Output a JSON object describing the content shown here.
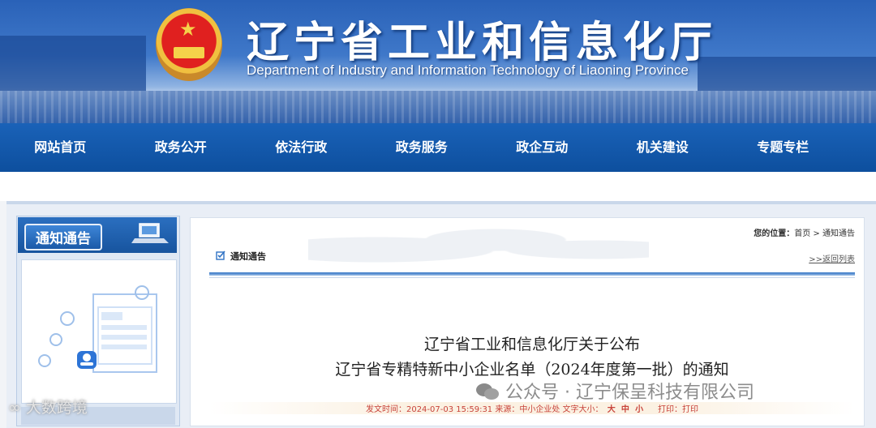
{
  "header": {
    "title": "辽宁省工业和信息化厅",
    "subtitle": "Department of Industry and Information Technology of Liaoning Province"
  },
  "nav": {
    "items": [
      {
        "label": "网站首页"
      },
      {
        "label": "政务公开"
      },
      {
        "label": "依法行政"
      },
      {
        "label": "政务服务"
      },
      {
        "label": "政企互动"
      },
      {
        "label": "机关建设"
      },
      {
        "label": "专题专栏"
      }
    ]
  },
  "sidebar": {
    "title": "通知通告"
  },
  "breadcrumb": {
    "prefix": "您的位置：",
    "home": "首页",
    "sep": " > ",
    "current": "通知通告"
  },
  "section": {
    "title": "通知通告",
    "back": ">>返回列表"
  },
  "article": {
    "title_line1": "辽宁省工业和信息化厅关于公布",
    "title_line2": "辽宁省专精特新中小企业名单（2024年度第一批）的通知",
    "meta_text": "发文时间：2024-07-03 15:59:31 来源：中小企业处 文字大小：",
    "size_large": "大",
    "size_medium": "中",
    "size_small": "小",
    "print_text": "打印：打印"
  },
  "watermarks": {
    "right": "公众号 · 辽宁保呈科技有限公司",
    "left": "大数跨境"
  },
  "colors": {
    "nav_bg": "#1a62b8",
    "accent_blue": "#2f72c4",
    "meta_red": "#c8433a"
  }
}
